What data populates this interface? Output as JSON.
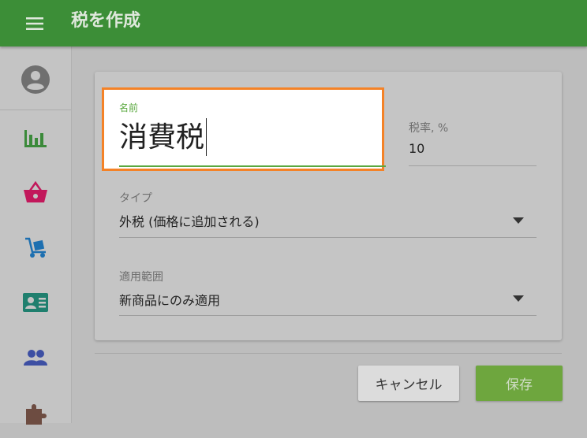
{
  "header": {
    "title": "税を作成",
    "menu_icon": "hamburger-menu-icon",
    "bar_color": "#3c8e37"
  },
  "sidebar": {
    "items": [
      {
        "icon": "account-circle-icon",
        "color": "#6f6f6f"
      },
      {
        "icon": "bar-chart-icon",
        "color": "#3b8a3a"
      },
      {
        "icon": "shopping-basket-icon",
        "color": "#c2185b"
      },
      {
        "icon": "dolly-icon",
        "color": "#1d6fb0"
      },
      {
        "icon": "contact-card-icon",
        "color": "#1f7f6e"
      },
      {
        "icon": "people-icon",
        "color": "#3d4fa3"
      },
      {
        "icon": "puzzle-icon",
        "color": "#6d4c41"
      }
    ]
  },
  "form": {
    "name": {
      "label": "名前",
      "value": "消費税"
    },
    "rate": {
      "label": "税率, %",
      "value": "10"
    },
    "type": {
      "label": "タイプ",
      "value": "外税 (価格に追加される)"
    },
    "scope": {
      "label": "適用範囲",
      "value": "新商品にのみ適用"
    }
  },
  "actions": {
    "cancel_label": "キャンセル",
    "save_label": "保存"
  },
  "colors": {
    "focus_outline": "#f48227",
    "accent_green": "#5aa83f"
  }
}
